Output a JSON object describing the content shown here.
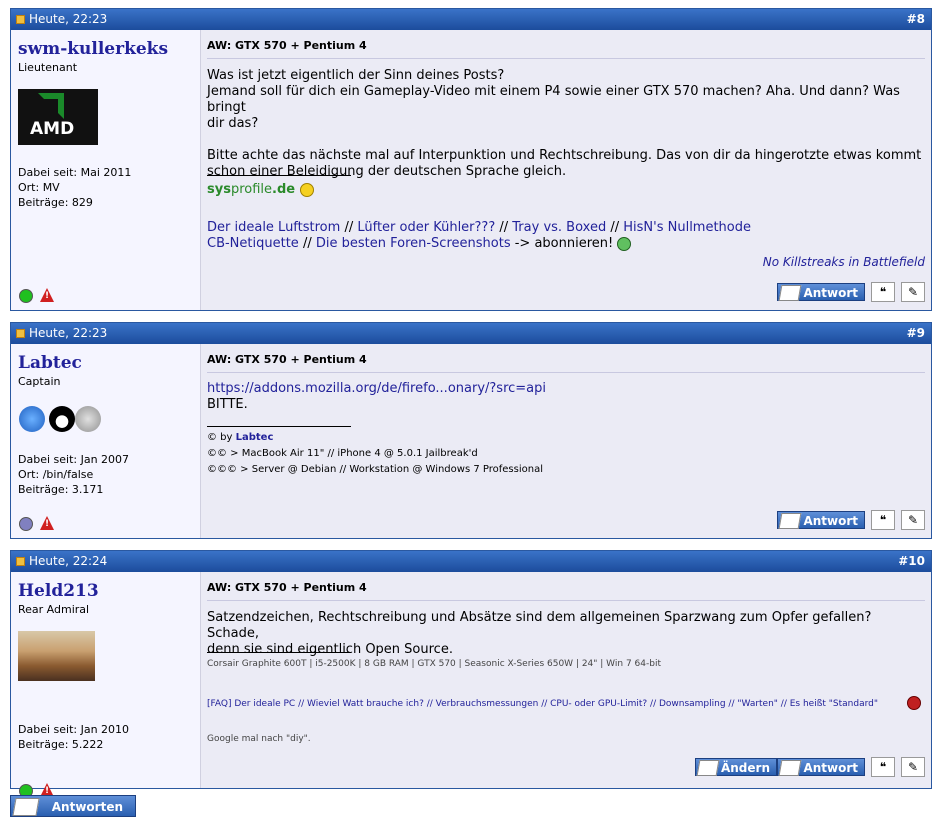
{
  "posts": [
    {
      "date": "Heute, 22:23",
      "number": "#8",
      "username": "swm-kullerkeks",
      "rank": "Lieutenant",
      "avatar_text": "AMD",
      "info": [
        "Dabei seit: Mai 2011",
        "Ort: MV",
        "Beiträge: 829"
      ],
      "title": "AW: GTX 570 + Pentium 4",
      "body": [
        "Was ist jetzt eigentlich der Sinn deines Posts?",
        "Jemand soll für dich ein Gameplay-Video mit einem P4 sowie einer GTX 570 machen? Aha. Und dann? Was bringt",
        "dir das?",
        "Bitte achte das nächste mal auf Interpunktion und Rechtschreibung. Das von dir da hingerotzte etwas kommt",
        "schon einer Beleidigung der deutschen Sprache gleich."
      ],
      "sig_logo_a": "sys",
      "sig_logo_b": "profile",
      "sig_logo_c": ".de",
      "sig_links_1": [
        "Der ideale Luftstrom",
        "Lüfter oder Kühler???",
        "Tray vs. Boxed",
        "HisN's Nullmethode"
      ],
      "sig_links_2": [
        "CB-Netiquette",
        "Die besten Foren-Screenshots"
      ],
      "sig_sep": "//",
      "sig_after": "-> abonnieren!",
      "sig_italic": "No Killstreaks in Battlefield",
      "reply_label": "Antwort"
    },
    {
      "date": "Heute, 22:23",
      "number": "#9",
      "username": "Labtec",
      "rank": "Captain",
      "info": [
        "Dabei seit: Jan 2007",
        "Ort: /bin/false",
        "Beiträge: 3.171"
      ],
      "title": "AW: GTX 570 + Pentium 4",
      "link": "https://addons.mozilla.org/de/firefo...onary/?src=api",
      "body2": "BITTE.",
      "sig_1a": "© by ",
      "sig_1b": "Labtec",
      "sig_2": "©© > MacBook Air 11\" // iPhone 4 @ 5.0.1 Jailbreak'd",
      "sig_3": "©©© > Server @ Debian // Workstation @ Windows 7 Professional",
      "reply_label": "Antwort"
    },
    {
      "date": "Heute, 22:24",
      "number": "#10",
      "username": "Held213",
      "rank": "Rear Admiral",
      "info": [
        "Dabei seit: Jan 2010",
        "Beiträge: 5.222"
      ],
      "title": "AW: GTX 570 + Pentium 4",
      "body": [
        "Satzendzeichen, Rechtschreibung und Absätze sind dem allgemeinen Sparzwang zum Opfer gefallen? Schade,",
        "denn sie sind eigentlich Open Source."
      ],
      "sig_specs": "Corsair Graphite 600T | i5-2500K | 8 GB RAM | GTX 570 | Seasonic X-Series 650W | 24\" | Win 7 64-bit",
      "sig_links": "[FAQ] Der ideale PC // Wieviel Watt brauche ich? // Verbrauchsmessungen // CPU- oder GPU-Limit? // Downsampling // \"Warten\" // Es heißt \"Standard\"",
      "sig_google": "Google mal nach \"diy\".",
      "edit_label": "Ändern",
      "reply_label": "Antwort"
    }
  ],
  "bottom_reply_label": "Antworten",
  "colors": {
    "header": "#1c4c9c",
    "username": "#22229a",
    "online": "#20c020",
    "offline": "#8080c0"
  }
}
